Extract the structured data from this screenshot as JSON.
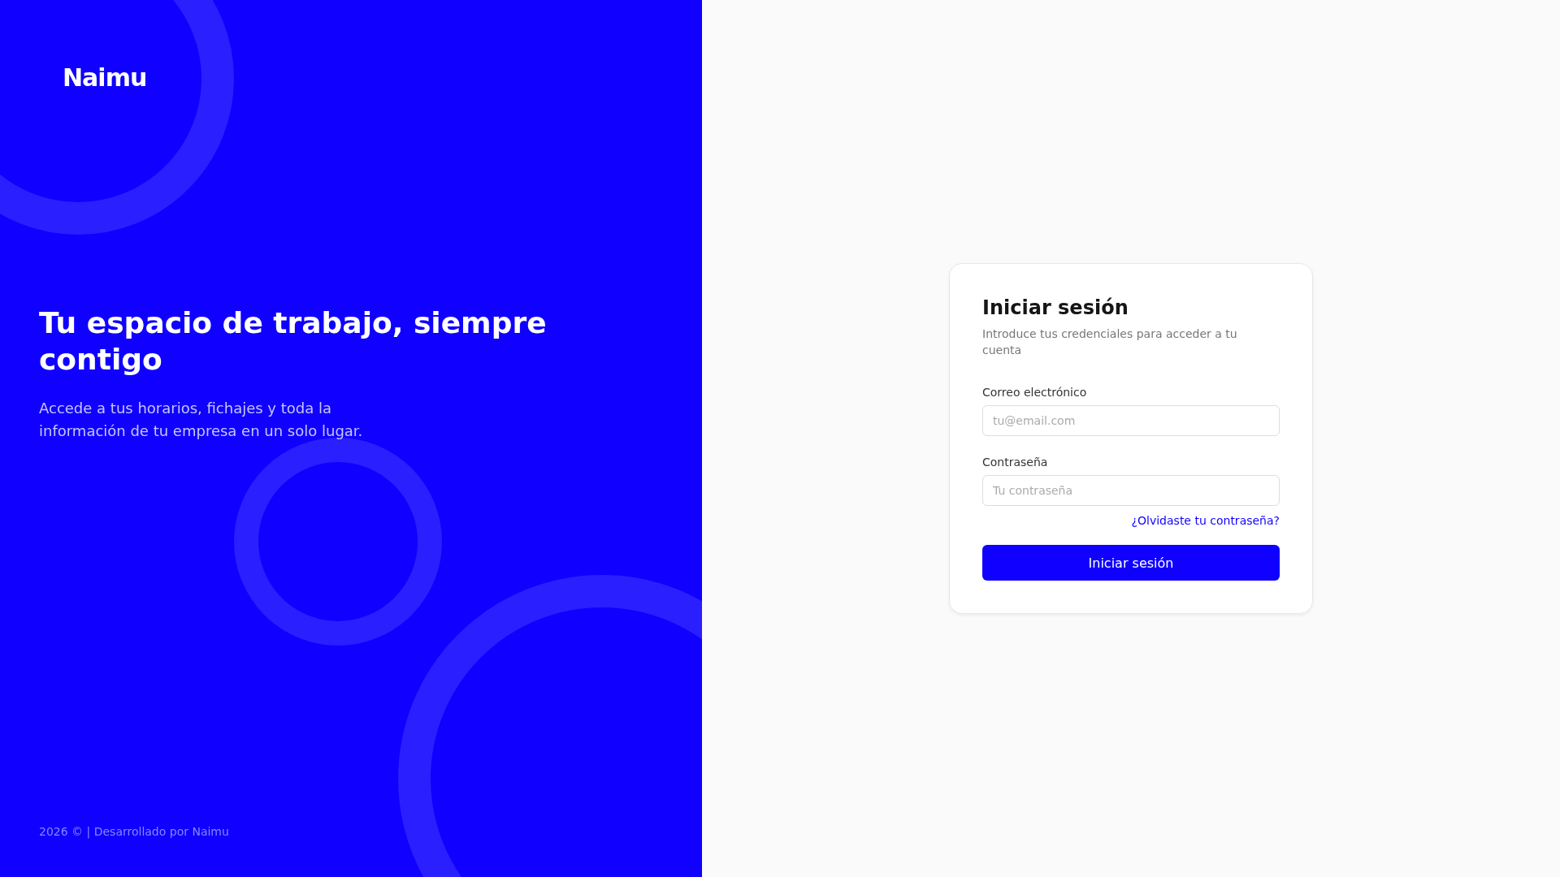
{
  "brand": {
    "logo": "Naimu"
  },
  "hero": {
    "title": "Tu espacio de trabajo, siempre contigo",
    "subtitle": "Accede a tus horarios, fichajes y toda la información de tu empresa en un solo lugar."
  },
  "footer": "2026 © | Desarrollado por Naimu",
  "login": {
    "title": "Iniciar sesión",
    "subtitle": "Introduce tus credenciales para acceder a tu cuenta",
    "fields": [
      {
        "label": "Correo electrónico",
        "placeholder": "tu@email.com"
      },
      {
        "label": "Contraseña",
        "placeholder": "Tu contraseña"
      }
    ],
    "forgot_link": "¿Olvidaste tu contraseña?",
    "submit": "Iniciar sesión"
  }
}
